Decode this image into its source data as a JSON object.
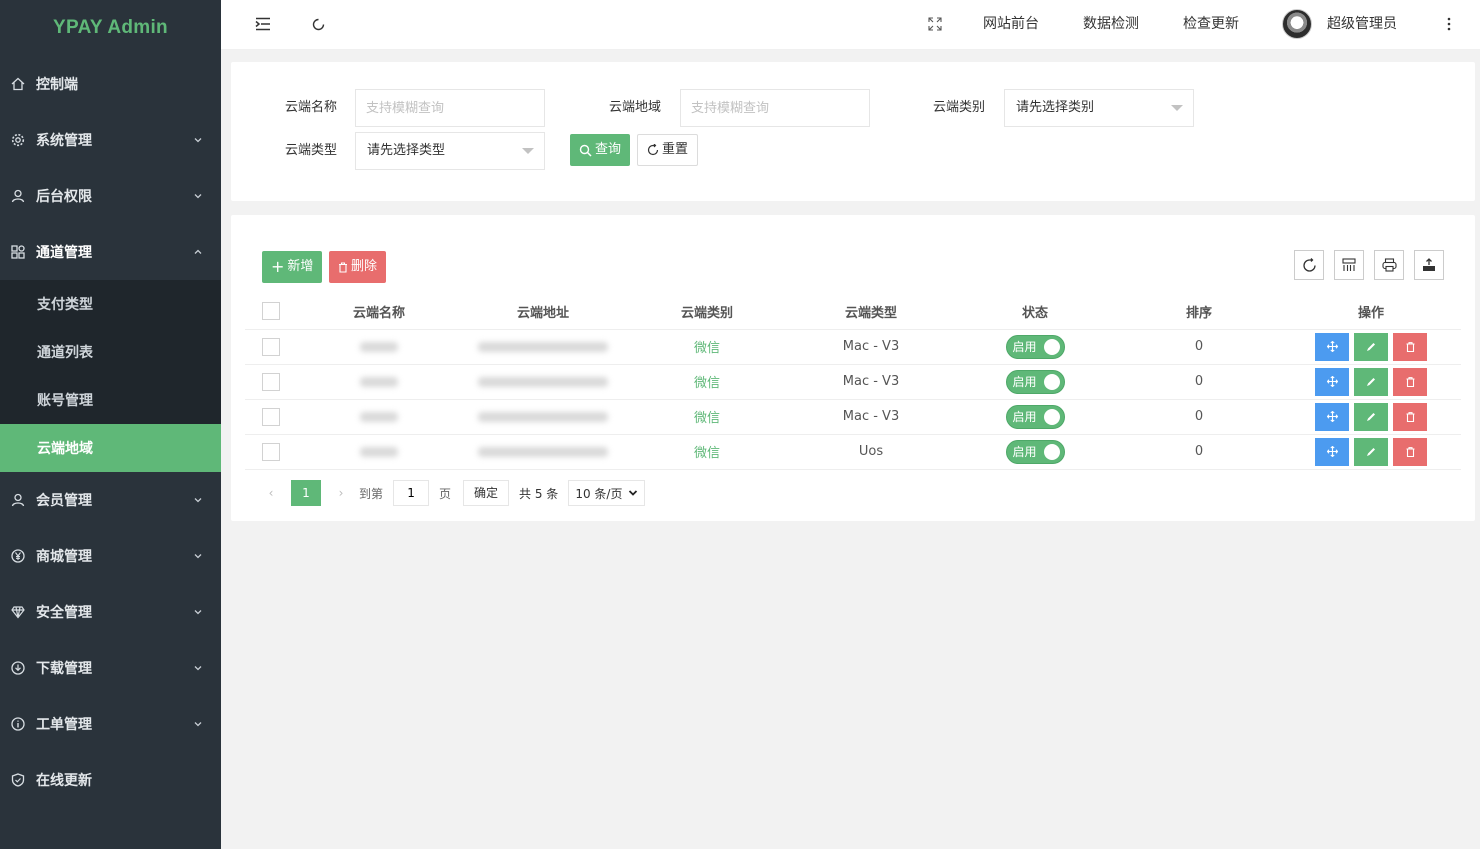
{
  "app": {
    "logo": "YPAY Admin"
  },
  "sidebar": {
    "items": [
      {
        "label": "控制端",
        "icon": "home-icon"
      },
      {
        "label": "系统管理",
        "icon": "gear-icon"
      },
      {
        "label": "后台权限",
        "icon": "user-icon"
      },
      {
        "label": "通道管理",
        "icon": "apps-icon"
      },
      {
        "label": "会员管理",
        "icon": "user-icon"
      },
      {
        "label": "商城管理",
        "icon": "yen-icon"
      },
      {
        "label": "安全管理",
        "icon": "diamond-icon"
      },
      {
        "label": "下载管理",
        "icon": "download-icon"
      },
      {
        "label": "工单管理",
        "icon": "info-icon"
      },
      {
        "label": "在线更新",
        "icon": "shield-icon"
      }
    ],
    "submenu": [
      "支付类型",
      "通道列表",
      "账号管理",
      "云端地域"
    ],
    "active_sub": "云端地域"
  },
  "header": {
    "links": [
      "网站前台",
      "数据检测",
      "检查更新"
    ],
    "user": "超级管理员"
  },
  "search": {
    "name_label": "云端名称",
    "name_placeholder": "支持模糊查询",
    "region_label": "云端地域",
    "region_placeholder": "支持模糊查询",
    "category_label": "云端类别",
    "category_value": "请先选择类别",
    "type_label": "云端类型",
    "type_value": "请先选择类型",
    "query_btn": "查询",
    "reset_btn": "重置"
  },
  "toolbar": {
    "add_btn": "新增",
    "delete_btn": "删除"
  },
  "table": {
    "headers": [
      "云端名称",
      "云端地址",
      "云端类别",
      "云端类型",
      "状态",
      "排序",
      "操作"
    ],
    "rows": [
      {
        "category": "微信",
        "type": "Mac - V3",
        "status": "启用",
        "sort": "0"
      },
      {
        "category": "微信",
        "type": "Mac - V3",
        "status": "启用",
        "sort": "0"
      },
      {
        "category": "微信",
        "type": "Mac - V3",
        "status": "启用",
        "sort": "0"
      },
      {
        "category": "微信",
        "type": "Uos",
        "status": "启用",
        "sort": "0"
      }
    ]
  },
  "pager": {
    "current": "1",
    "goto_label": "到第",
    "page_input": "1",
    "page_unit": "页",
    "confirm": "确定",
    "total": "共 5 条",
    "per_page": "10 条/页"
  },
  "colors": {
    "accent": "#5fb878",
    "danger": "#e86d6d",
    "info": "#4c9bf0",
    "sidebar": "#2a333b"
  }
}
